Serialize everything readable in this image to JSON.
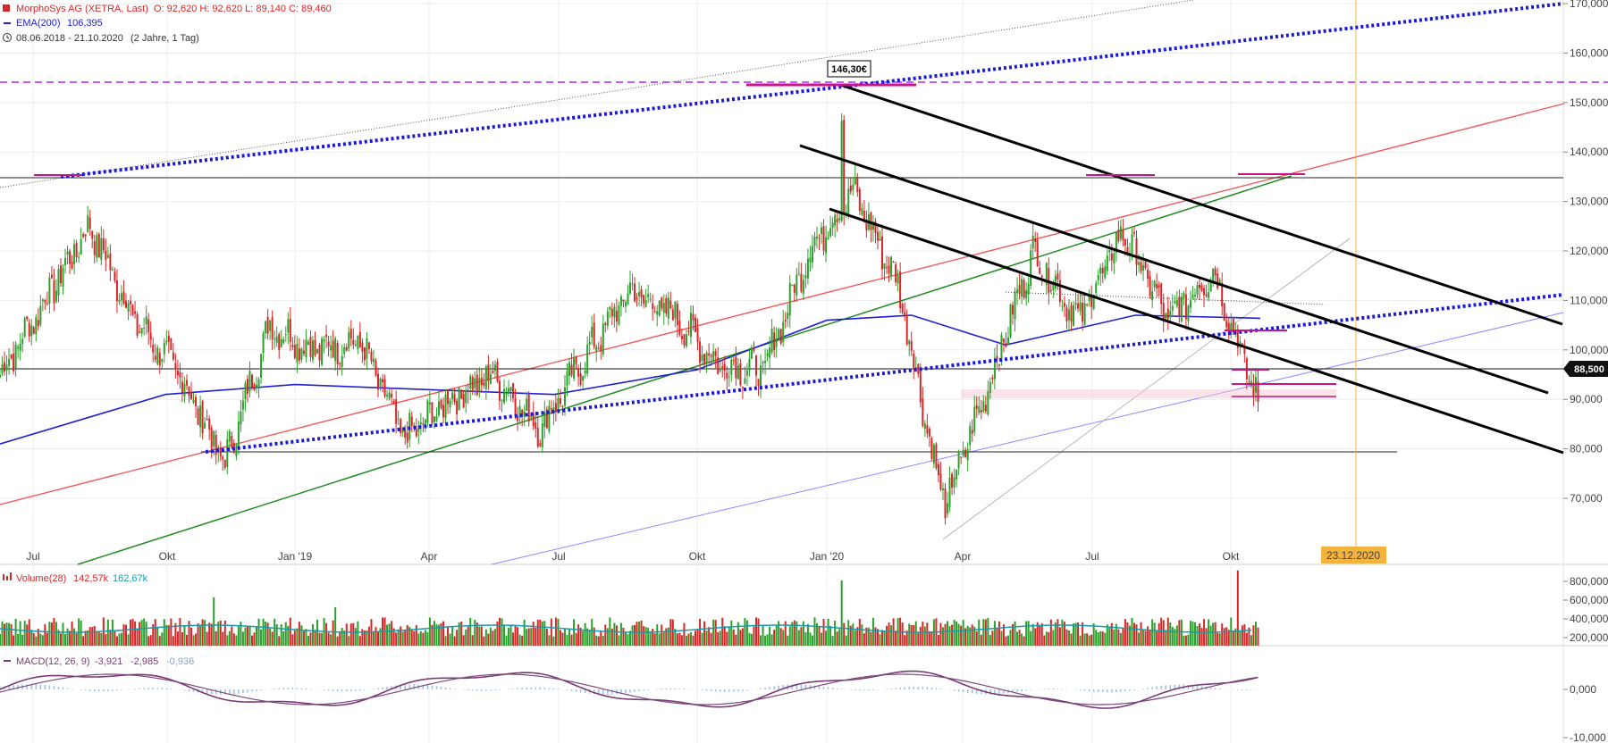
{
  "legend": {
    "title": "MorphoSys AG (XETRA, Last)",
    "ohlc": "O: 92,620  H: 92,620  L: 89,140  C: 89,460",
    "ema_label": "EMA(200)",
    "ema_value": "106,395",
    "range_label": "08.06.2018 - 21.10.2020",
    "range_note": "(2 Jahre, 1 Tag)"
  },
  "annotations": {
    "high_label": "146,30€",
    "last_price": "88,500",
    "date_marker": "23.12.2020"
  },
  "volume_panel": {
    "label": "Volume(28)",
    "v1": "142,57k",
    "v2": "162,67k",
    "ticks": [
      "800,000",
      "600,000",
      "400,000",
      "200,000"
    ]
  },
  "macd_panel": {
    "label": "MACD(12, 26, 9)",
    "v1": "-3,921",
    "v2": "-2,985",
    "v3": "-0,936",
    "ticks": [
      "0,000",
      "-10,000"
    ]
  },
  "colors": {
    "up": "#2ca02c",
    "down": "#d62728",
    "ema": "#1f1fd6",
    "macd": "#7a3a78",
    "signal": "#7b4a7b",
    "hist": "#9cc3e8",
    "magenta": "#c71585",
    "violet": "#b026ff"
  },
  "chart_data": {
    "type": "candlestick",
    "title": "MorphoSys AG (XETRA, Last)",
    "x_tick_labels": [
      "Jul",
      "Okt",
      "Jan '19",
      "Apr",
      "Jul",
      "Okt",
      "Jan '20",
      "Apr",
      "Jul",
      "Okt"
    ],
    "y_tick_labels": [
      "70,000",
      "80,000",
      "90,000",
      "100,000",
      "110,000",
      "120,000",
      "130,000",
      "140,000",
      "150,000",
      "160,000",
      "170,000"
    ],
    "ylim": [
      63,
      172
    ],
    "price_key_points": [
      {
        "date": "Jun 2018",
        "close": 95
      },
      {
        "date": "Jul 2018",
        "close": 110
      },
      {
        "date": "Aug 2018",
        "close": 125
      },
      {
        "date": "Sep 2018",
        "close": 106
      },
      {
        "date": "Okt 2018",
        "close": 95
      },
      {
        "date": "Nov 2018",
        "close": 77
      },
      {
        "date": "Dez 2018",
        "close": 105
      },
      {
        "date": "Jan 2019",
        "close": 100
      },
      {
        "date": "Feb 2019",
        "close": 102
      },
      {
        "date": "Mrz 2019",
        "close": 82
      },
      {
        "date": "Apr 2019",
        "close": 90
      },
      {
        "date": "Mai 2019",
        "close": 95
      },
      {
        "date": "Jun 2019",
        "close": 84
      },
      {
        "date": "Jul 2019",
        "close": 98
      },
      {
        "date": "Aug 2019",
        "close": 112
      },
      {
        "date": "Sep 2019",
        "close": 107
      },
      {
        "date": "Okt 2019",
        "close": 97
      },
      {
        "date": "Nov 2019",
        "close": 96
      },
      {
        "date": "Dez 2019",
        "close": 120
      },
      {
        "date": "Jan 2020",
        "close": 132
      },
      {
        "date": "Feb 2020",
        "close": 113
      },
      {
        "date": "Mrz 2020",
        "close": 68
      },
      {
        "date": "Apr 2020",
        "close": 93
      },
      {
        "date": "Mai 2020",
        "close": 120
      },
      {
        "date": "Jun 2020",
        "close": 106
      },
      {
        "date": "Jul 2020",
        "close": 124
      },
      {
        "date": "Aug 2020",
        "close": 106
      },
      {
        "date": "Sep 2020",
        "close": 116
      },
      {
        "date": "Okt 2020",
        "close": 89.46
      }
    ],
    "ema200_key_points": [
      {
        "date": "Jun 2018",
        "value": 81
      },
      {
        "date": "Sep 2018",
        "value": 91
      },
      {
        "date": "Jan 2019",
        "value": 93
      },
      {
        "date": "Jul 2019",
        "value": 91
      },
      {
        "date": "Okt 2019",
        "value": 96
      },
      {
        "date": "Jan 2020",
        "value": 106
      },
      {
        "date": "Feb 2020",
        "value": 107
      },
      {
        "date": "Apr 2020",
        "value": 101
      },
      {
        "date": "Jul 2020",
        "value": 107
      },
      {
        "date": "Okt 2020",
        "value": 106.395
      }
    ],
    "highs": {
      "alltime": 146.3
    },
    "horizontal_levels": [
      125,
      88.5,
      76.5,
      147.5
    ],
    "last": 88.5,
    "marker_date": "23.12.2020"
  }
}
